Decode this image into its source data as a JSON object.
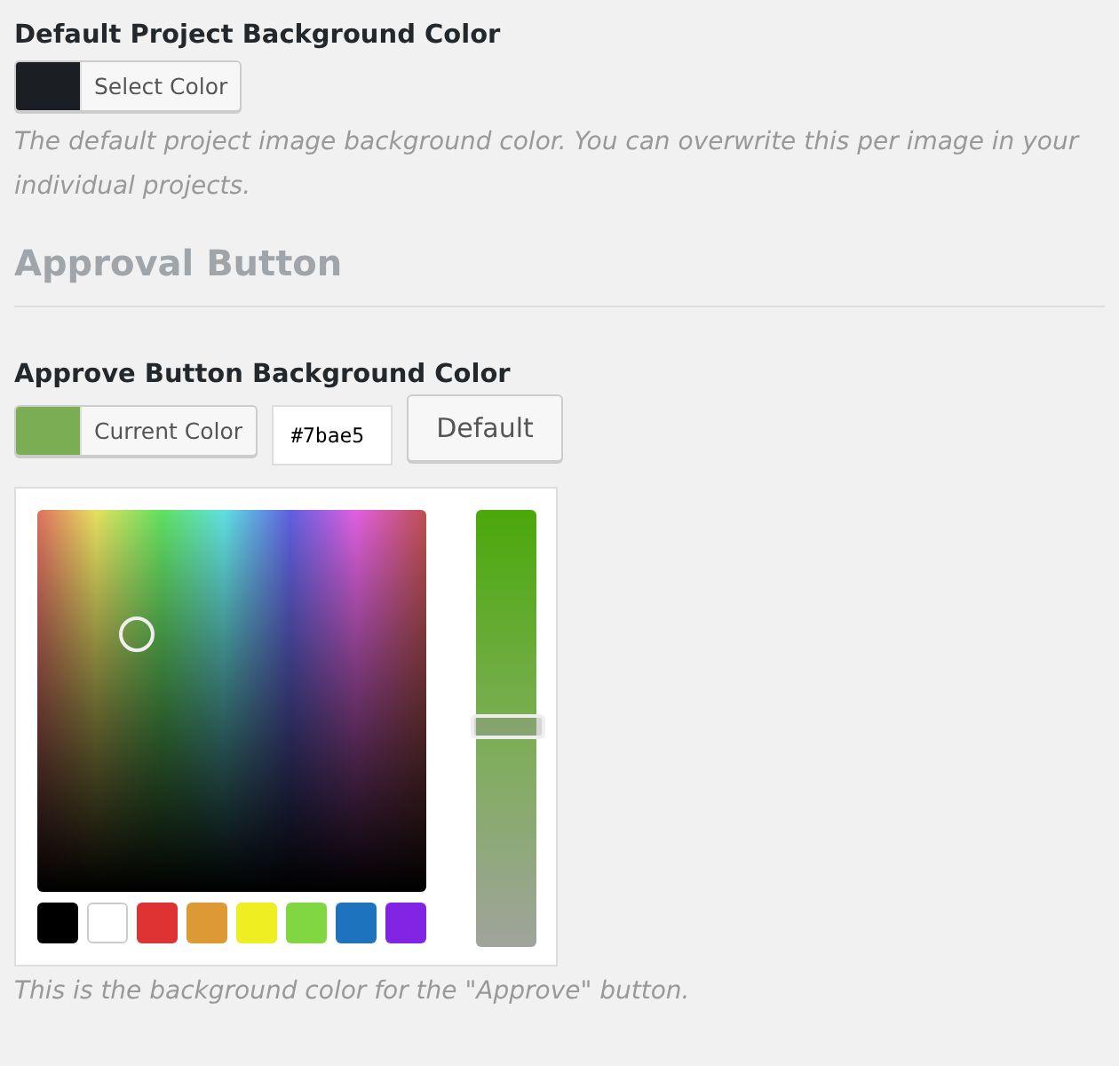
{
  "fields": [
    {
      "label": "Default Project Background Color",
      "color_button": {
        "label": "Select Color",
        "color": "#1b1e23"
      },
      "description": "The default project image background color. You can overwrite this per image in your individual projects."
    }
  ],
  "section_title": "Approval Button",
  "approve_field": {
    "label": "Approve Button Background Color",
    "color_button": {
      "label": "Current Color",
      "color": "#7bae54"
    },
    "hex_input": {
      "value": "#7bae5"
    },
    "default_button": "Default",
    "picker": {
      "level": 0.51,
      "palette": [
        {
          "color": "#000000"
        },
        {
          "color": "#ffffff"
        },
        {
          "color": "#dd3333"
        },
        {
          "color": "#dd9933"
        },
        {
          "color": "#eeee22"
        },
        {
          "color": "#81d742"
        },
        {
          "color": "#1e73be"
        },
        {
          "color": "#8224e3"
        }
      ]
    },
    "description": "This is the background color for the \"Approve\" button."
  }
}
